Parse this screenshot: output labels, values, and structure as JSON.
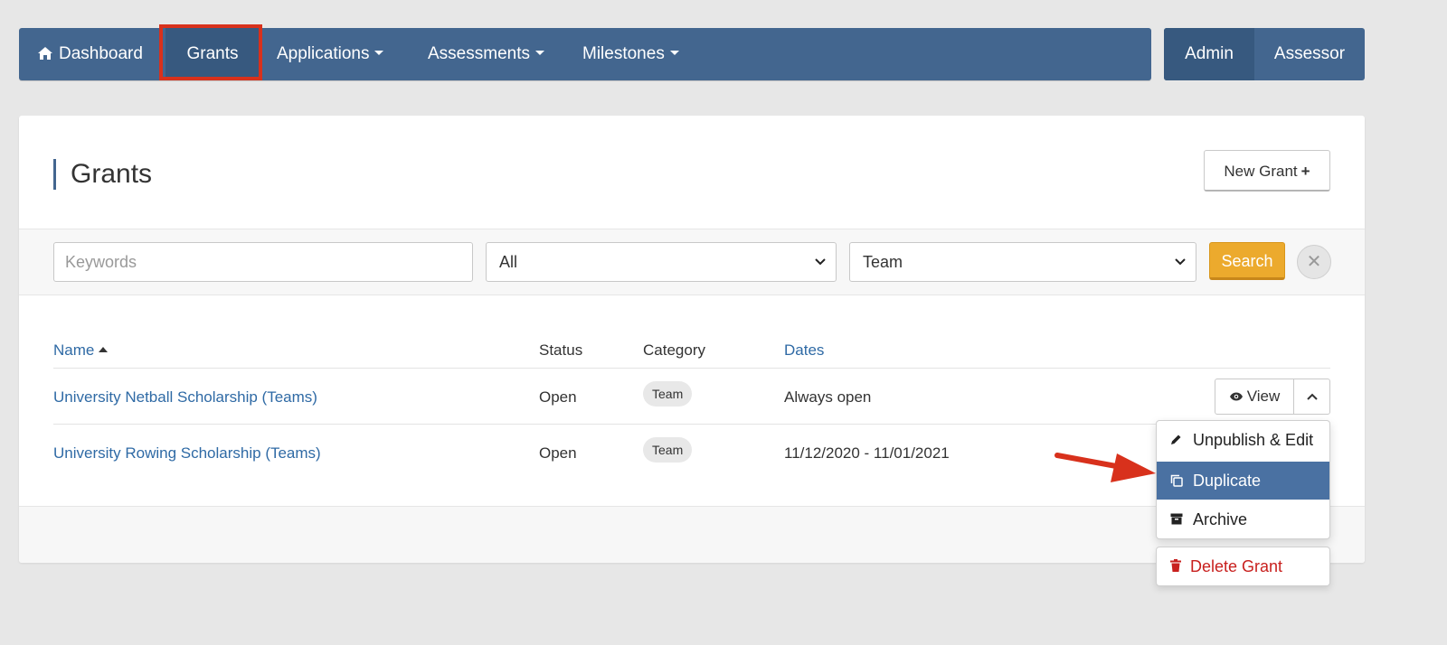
{
  "nav": {
    "items": [
      {
        "label": "Dashboard",
        "icon": "home-icon"
      },
      {
        "label": "Grants",
        "active": true
      },
      {
        "label": "Applications",
        "dropdown": true
      },
      {
        "label": "Assessments",
        "dropdown": true
      },
      {
        "label": "Milestones",
        "dropdown": true
      }
    ],
    "roles": [
      {
        "label": "Admin",
        "active": true
      },
      {
        "label": "Assessor"
      }
    ]
  },
  "page": {
    "title": "Grants",
    "new_button": "New Grant"
  },
  "filters": {
    "keywords_placeholder": "Keywords",
    "status_value": "All",
    "category_value": "Team",
    "search_label": "Search"
  },
  "table": {
    "columns": [
      "Name",
      "Status",
      "Category",
      "Dates"
    ],
    "rows": [
      {
        "name": "University Netball Scholarship (Teams)",
        "status": "Open",
        "category": "Team",
        "dates": "Always open"
      },
      {
        "name": "University Rowing Scholarship (Teams)",
        "status": "Open",
        "category": "Team",
        "dates": "11/12/2020 - 11/01/2021"
      }
    ]
  },
  "row_actions": {
    "view_label": "View",
    "menu": {
      "unpublish": "Unpublish & Edit",
      "duplicate": "Duplicate",
      "archive": "Archive",
      "delete": "Delete Grant"
    }
  },
  "colors": {
    "nav_bg": "#43668f",
    "link": "#2f6aa5",
    "search_btn": "#ecaa2d",
    "highlight": "#d8311c",
    "danger": "#c8201e",
    "menu_active": "#4a71a2"
  }
}
